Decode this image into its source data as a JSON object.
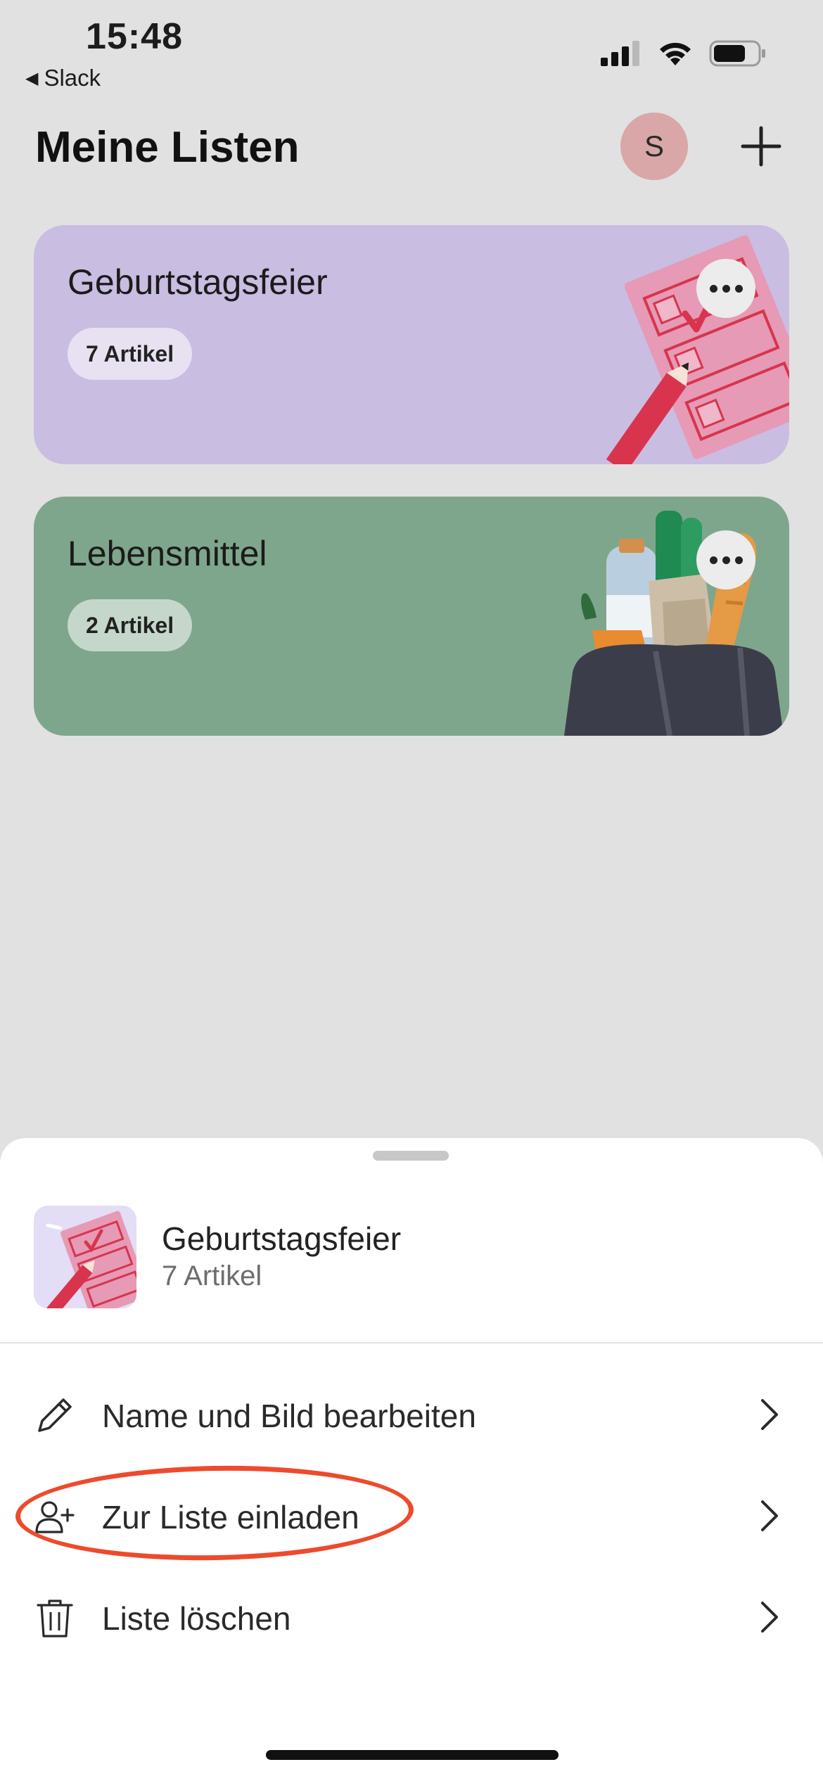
{
  "status_bar": {
    "time": "15:48",
    "back_app": "Slack",
    "icons": [
      "cellular-signal-icon",
      "wifi-icon",
      "battery-icon"
    ]
  },
  "header": {
    "title": "Meine Listen",
    "avatar_initial": "S",
    "add_icon": "plus-icon"
  },
  "lists": [
    {
      "title": "Geburtstagsfeier",
      "count": "7 Artikel",
      "color": "#c9bde2",
      "art": "checklist-illustration"
    },
    {
      "title": "Lebensmittel",
      "count": "2 Artikel",
      "color": "#7ea68c",
      "art": "grocery-bag-illustration"
    }
  ],
  "sheet": {
    "title": "Geburtstagsfeier",
    "subtitle": "7 Artikel",
    "menu": [
      {
        "label": "Name und Bild bearbeiten",
        "icon": "pencil-icon"
      },
      {
        "label": "Zur Liste einladen",
        "icon": "add-person-icon",
        "highlighted": true
      },
      {
        "label": "Liste löschen",
        "icon": "trash-icon"
      }
    ]
  },
  "colors": {
    "background": "#e1e1e1",
    "avatar": "#d9a7a7",
    "annotation": "#ee4a2c",
    "accent_red": "#e0393e"
  }
}
